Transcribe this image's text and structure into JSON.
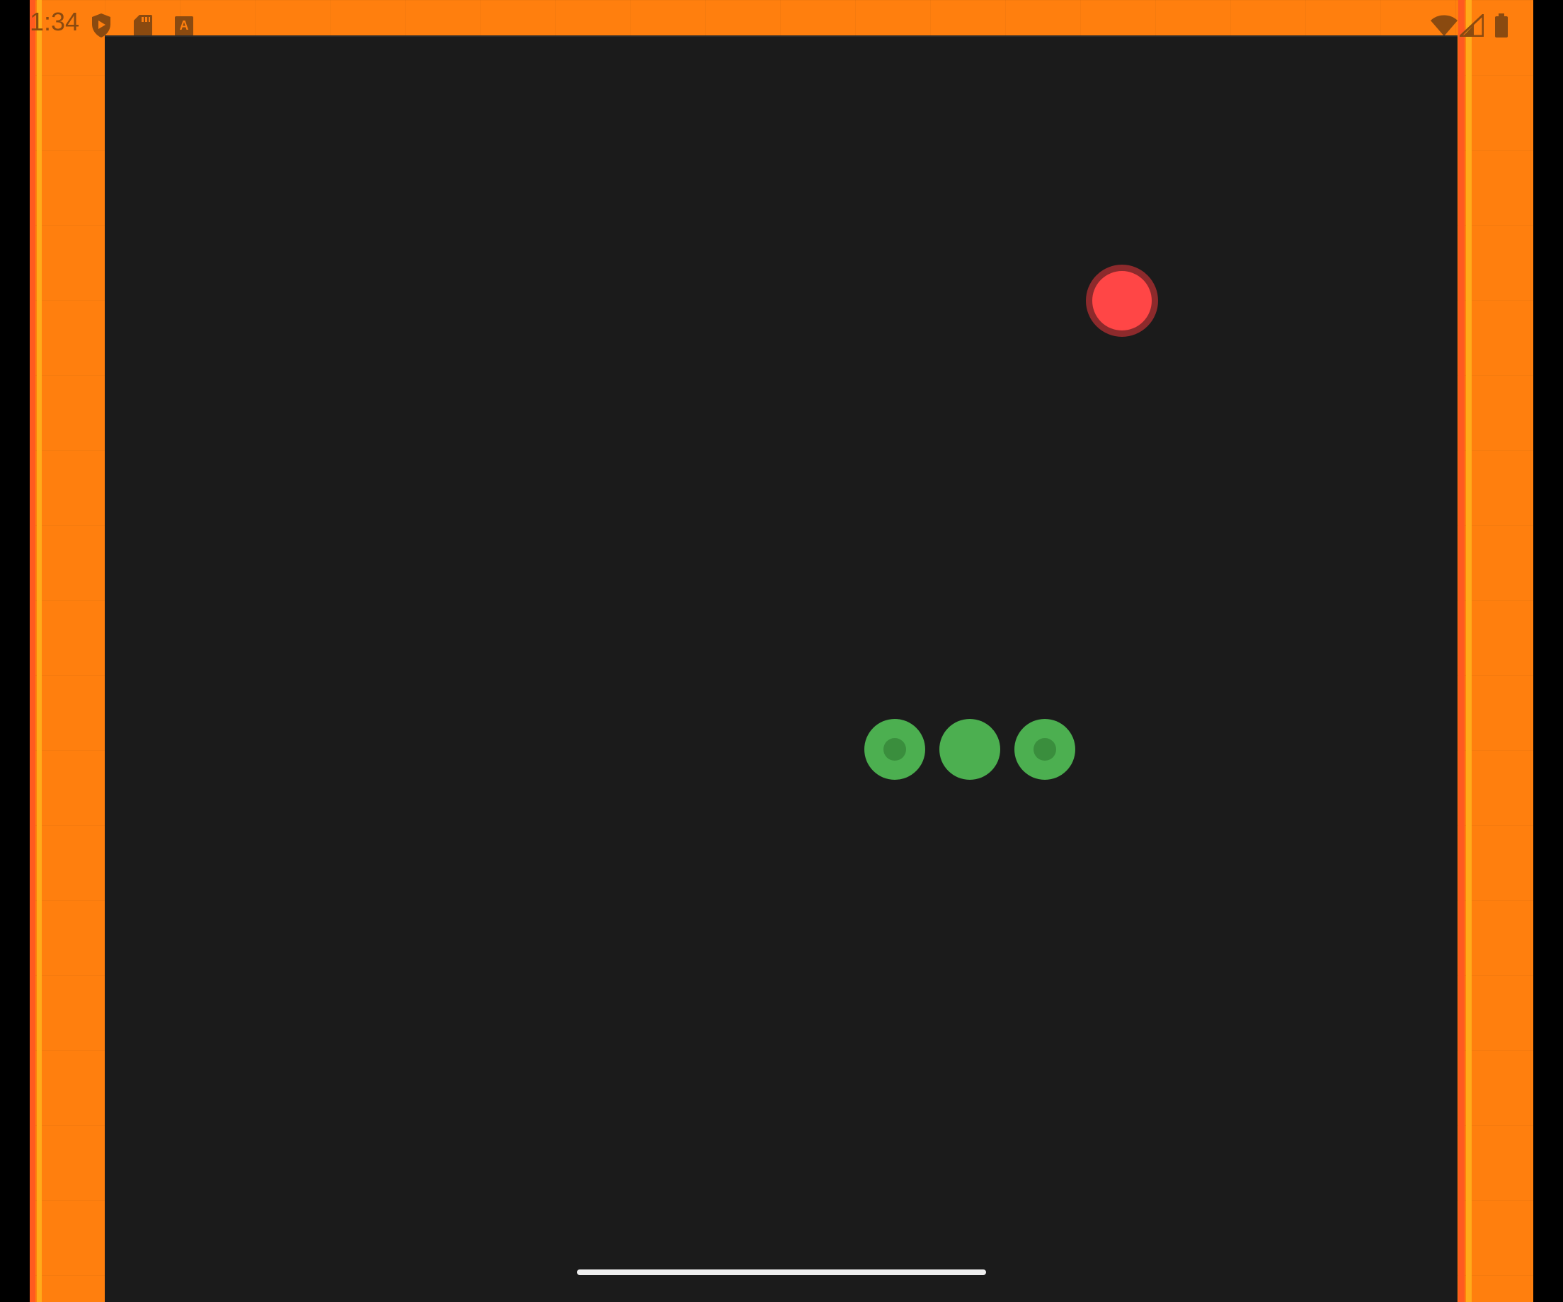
{
  "status_bar": {
    "time": "1:34",
    "left_icons": [
      "play-protect-shield-icon",
      "sd-card-icon",
      "text-a-icon"
    ],
    "right_icons": [
      "wifi-icon",
      "cell-signal-icon",
      "battery-icon"
    ],
    "text_color": "#8a4a10"
  },
  "game": {
    "background_color": "#1b1b1b",
    "frame_color": "#ff7f0e",
    "target": {
      "color": "#ff4646",
      "ring_color": "#8d2a2c"
    },
    "snake": {
      "color": "#4caf50",
      "eye_color": "#3a8e3d",
      "segments": [
        {
          "type": "eye-segment"
        },
        {
          "type": "plain-segment"
        },
        {
          "type": "eye-segment"
        }
      ]
    }
  },
  "navigation": {
    "home_indicator": "gesture-bar"
  }
}
